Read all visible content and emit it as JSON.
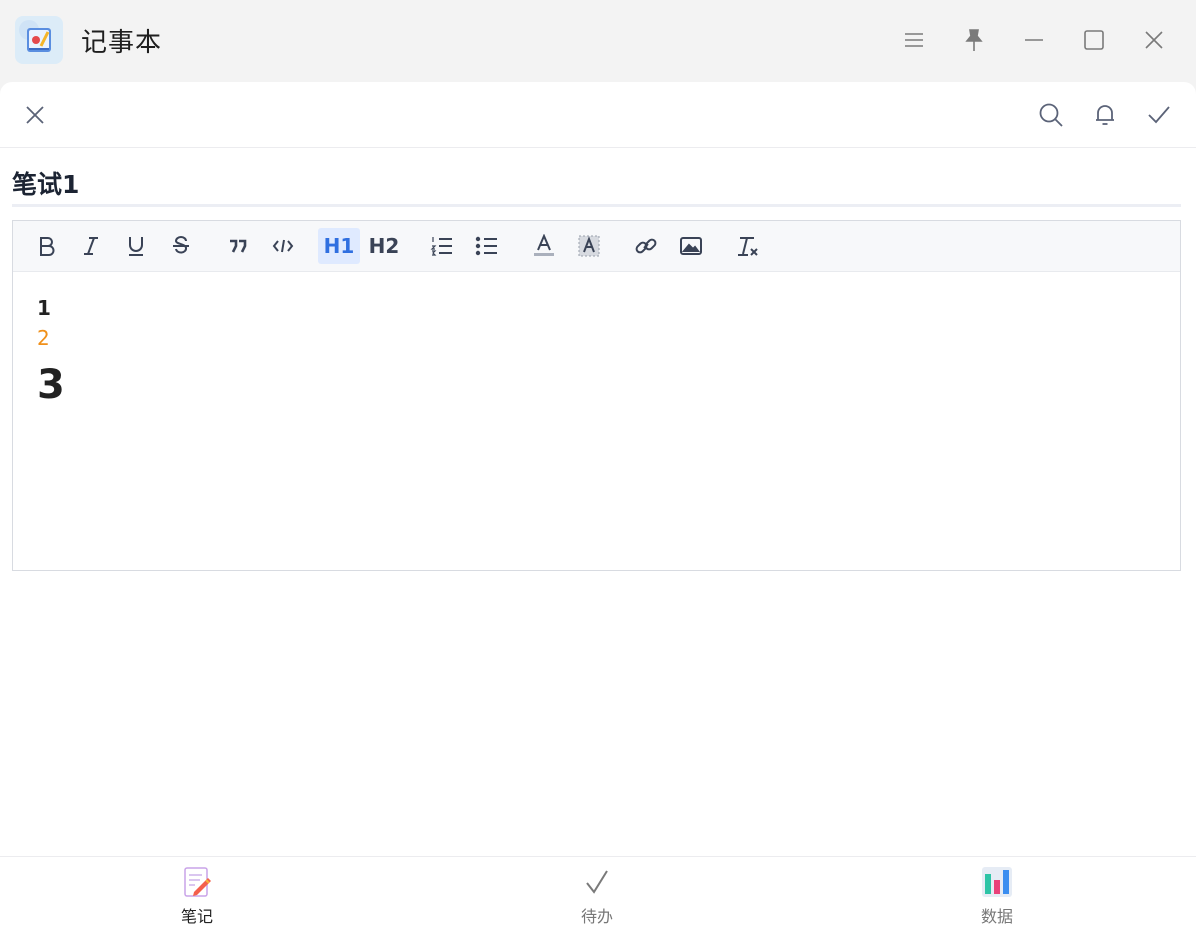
{
  "app": {
    "title": "记事本",
    "icon": "notebook-app-icon"
  },
  "window_controls": [
    "menu-icon",
    "pin-icon",
    "minimize-icon",
    "maximize-icon",
    "close-icon"
  ],
  "topbar": {
    "left": "close-icon",
    "right": [
      "search-icon",
      "bell-icon",
      "check-icon"
    ]
  },
  "note": {
    "title": "笔试1"
  },
  "toolbar": {
    "h1_label": "H1",
    "h2_label": "H2",
    "active": "h1",
    "items": [
      "bold-icon",
      "italic-icon",
      "underline-icon",
      "strikethrough-icon",
      "quote-icon",
      "code-icon",
      "h1",
      "h2",
      "ordered-list-icon",
      "bullet-list-icon",
      "font-color-icon",
      "background-color-icon",
      "link-icon",
      "image-icon",
      "clear-format-icon"
    ]
  },
  "content": {
    "line1": "1",
    "line2": "2",
    "line3": "3",
    "line2_color": "#f0901a"
  },
  "bottom_nav": {
    "items": [
      {
        "label": "笔记",
        "icon": "note-edit-icon",
        "active": true
      },
      {
        "label": "待办",
        "icon": "todo-check-icon",
        "active": false
      },
      {
        "label": "数据",
        "icon": "bar-chart-icon",
        "active": false
      }
    ]
  },
  "colors": {
    "accent": "#2f6fe0",
    "active_bg": "#dfeaff",
    "title_bar": "#f3f3f3"
  }
}
